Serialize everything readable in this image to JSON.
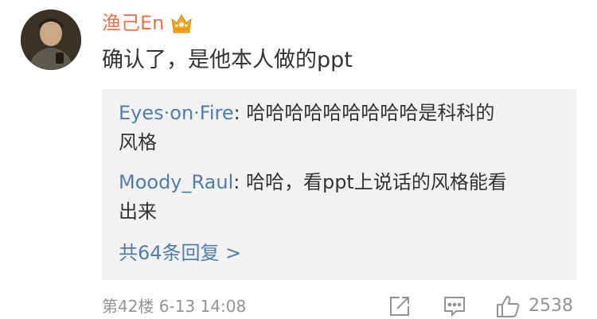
{
  "comment": {
    "username": "渔己En",
    "text": "确认了，是他本人做的ppt",
    "badge_icon": "crown-icon"
  },
  "replies": [
    {
      "user": "Eyes·on·Fire",
      "separator": ": ",
      "text_line1": "哈哈哈哈哈哈哈哈哈是科科的",
      "text_line2": "风格"
    },
    {
      "user": "Moody_Raul",
      "separator": ": ",
      "text_line1": "哈哈，看ppt上说话的风格能看",
      "text_line2": "出来"
    }
  ],
  "more_replies": "共64条回复 >",
  "footer": {
    "floor_info": "第42楼 6-13 14:08",
    "like_count": "2538"
  },
  "colors": {
    "username": "#eb7350",
    "link": "#507daf",
    "meta": "#939393",
    "reply_bg": "#f2f2f2"
  }
}
